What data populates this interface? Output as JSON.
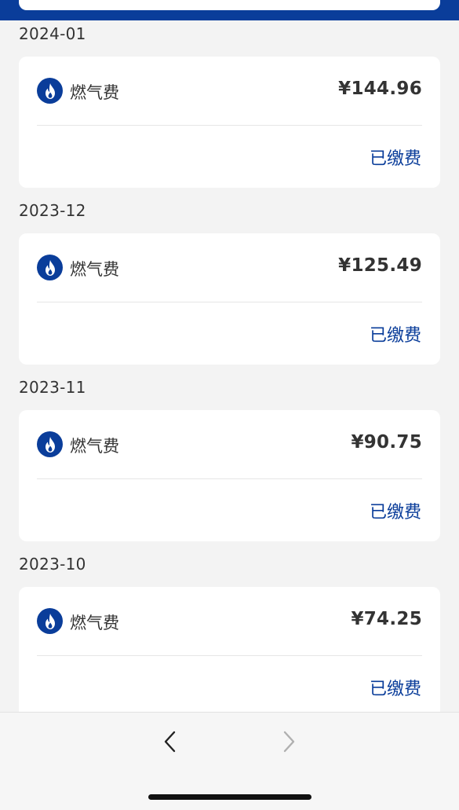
{
  "colors": {
    "brand": "#0a3d9a",
    "background": "#f3f3f3",
    "card": "#ffffff",
    "text": "#333333"
  },
  "bills": [
    {
      "month": "2024-01",
      "name": "燃气费",
      "amount": "¥144.96",
      "status": "已缴费",
      "icon": "flame-icon"
    },
    {
      "month": "2023-12",
      "name": "燃气费",
      "amount": "¥125.49",
      "status": "已缴费",
      "icon": "flame-icon"
    },
    {
      "month": "2023-11",
      "name": "燃气费",
      "amount": "¥90.75",
      "status": "已缴费",
      "icon": "flame-icon"
    },
    {
      "month": "2023-10",
      "name": "燃气费",
      "amount": "¥74.25",
      "status": "已缴费",
      "icon": "flame-icon"
    }
  ],
  "navigation": {
    "back_icon": "chevron-left-icon",
    "forward_icon": "chevron-right-icon",
    "forward_enabled": false
  }
}
